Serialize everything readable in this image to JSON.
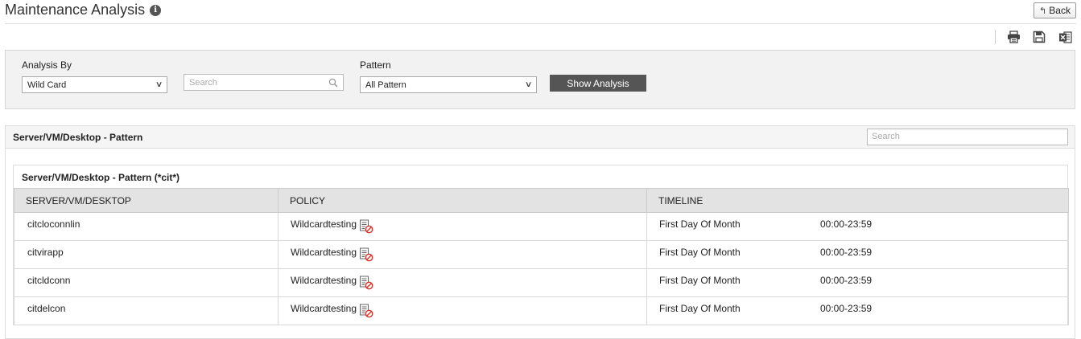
{
  "page": {
    "title": "Maintenance Analysis",
    "back_label": "Back"
  },
  "toolbar": {
    "icons": [
      "print-icon",
      "save-icon",
      "export-excel-icon"
    ]
  },
  "filters": {
    "analysis_by_label": "Analysis By",
    "analysis_by_value": "Wild Card",
    "search_placeholder": "Search",
    "pattern_label": "Pattern",
    "pattern_value": "All Pattern",
    "show_analysis_label": "Show Analysis"
  },
  "results": {
    "panel_title": "Server/VM/Desktop - Pattern",
    "search_placeholder": "Search",
    "table_title": "Server/VM/Desktop - Pattern (*cit*)",
    "columns": [
      "SERVER/VM/DESKTOP",
      "POLICY",
      "TIMELINE"
    ],
    "rows": [
      {
        "server": "citcloconnlin",
        "policy": "Wildcardtesting",
        "timeline_day": "First Day Of Month",
        "timeline_time": "00:00-23:59"
      },
      {
        "server": "citvirapp",
        "policy": "Wildcardtesting",
        "timeline_day": "First Day Of Month",
        "timeline_time": "00:00-23:59"
      },
      {
        "server": "citcldconn",
        "policy": "Wildcardtesting",
        "timeline_day": "First Day Of Month",
        "timeline_time": "00:00-23:59"
      },
      {
        "server": "citdelcon",
        "policy": "Wildcardtesting",
        "timeline_day": "First Day Of Month",
        "timeline_time": "00:00-23:59"
      }
    ]
  },
  "colors": {
    "button_dark": "#555555",
    "policy_icon_red": "#d9342b",
    "header_bg": "#e3e3e3"
  }
}
